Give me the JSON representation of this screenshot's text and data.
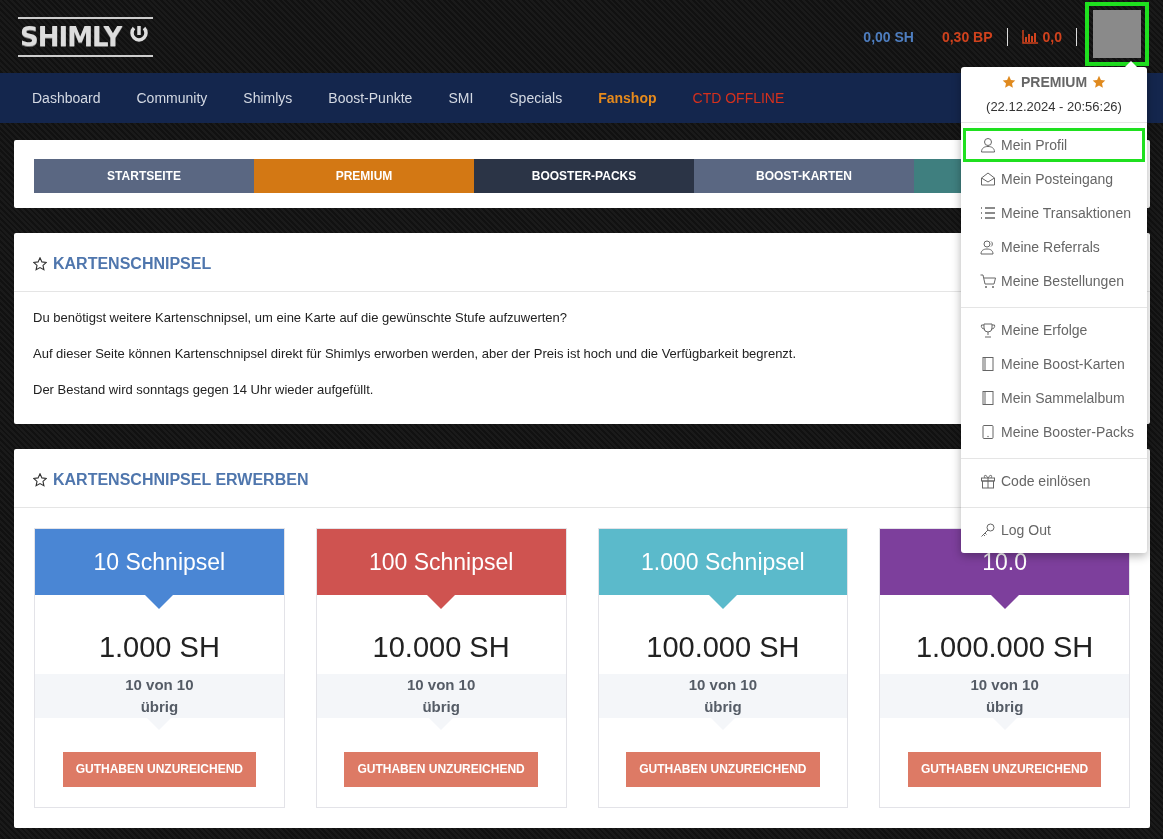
{
  "header": {
    "logo": "SHIMLY",
    "balances": [
      {
        "text": "0,00 SH",
        "kind": "sh"
      },
      {
        "text": "0,30 BP",
        "kind": "bp"
      },
      {
        "text": "0,0",
        "kind": "stats"
      }
    ],
    "avatar_highlighted": true
  },
  "nav": [
    {
      "label": "Dashboard",
      "kind": "normal"
    },
    {
      "label": "Community",
      "kind": "normal"
    },
    {
      "label": "Shimlys",
      "kind": "normal"
    },
    {
      "label": "Boost-Punkte",
      "kind": "normal"
    },
    {
      "label": "SMI",
      "kind": "normal"
    },
    {
      "label": "Specials",
      "kind": "normal"
    },
    {
      "label": "Fanshop",
      "kind": "active"
    },
    {
      "label": "CTD OFFLINE",
      "kind": "offline"
    }
  ],
  "shop_tabs": [
    {
      "label": "STARTSEITE",
      "color": "#5a6782"
    },
    {
      "label": "PREMIUM",
      "color": "#d37814"
    },
    {
      "label": "BOOSTER-PACKS",
      "color": "#2b3446"
    },
    {
      "label": "BOOST-KARTEN",
      "color": "#5a6782"
    },
    {
      "color": "#3f7f7f"
    }
  ],
  "info_panel": {
    "title": "KARTENSCHNIPSEL",
    "paragraphs": [
      "Du benötigst weitere Kartenschnipsel, um eine Karte auf die gewünschte Stufe aufzuwerten?",
      "Auf dieser Seite können Kartenschnipsel direkt für Shimlys erworben werden, aber der Preis ist hoch und die Verfügbarkeit begrenzt.",
      "Der Bestand wird sonntags gegen 14 Uhr wieder aufgefüllt."
    ]
  },
  "offers_panel": {
    "title": "KARTENSCHNIPSEL ERWERBEN",
    "cards": [
      {
        "title": "10 Schnipsel",
        "color": "#4a86d4",
        "price": "1.000 SH",
        "stock": "10 von 10",
        "stock_unit": "übrig",
        "button": "GUTHABEN UNZUREICHEND"
      },
      {
        "title": "100 Schnipsel",
        "color": "#cf5350",
        "price": "10.000 SH",
        "stock": "10 von 10",
        "stock_unit": "übrig",
        "button": "GUTHABEN UNZUREICHEND"
      },
      {
        "title": "1.000 Schnipsel",
        "color": "#5bbacb",
        "price": "100.000 SH",
        "stock": "10 von 10",
        "stock_unit": "übrig",
        "button": "GUTHABEN UNZUREICHEND"
      },
      {
        "title": "10.0",
        "color": "#7d3f9c",
        "price": "1.000.000 SH",
        "stock": "10 von 10",
        "stock_unit": "übrig",
        "button": "GUTHABEN UNZUREICHEND"
      }
    ]
  },
  "user_menu": {
    "status": "PREMIUM",
    "date": "(22.12.2024 - 20:56:26)",
    "groups": [
      [
        {
          "label": "Mein Profil",
          "selected": true
        },
        {
          "label": "Mein Posteingang",
          "selected": false
        },
        {
          "label": "Meine Transaktionen",
          "selected": false
        },
        {
          "label": "Meine Referrals",
          "selected": false
        },
        {
          "label": "Meine Bestellungen",
          "selected": false
        }
      ],
      [
        {
          "label": "Meine Erfolge",
          "selected": false
        },
        {
          "label": "Meine Boost-Karten",
          "selected": false
        },
        {
          "label": "Mein Sammelalbum",
          "selected": false
        },
        {
          "label": "Meine Booster-Packs",
          "selected": false
        }
      ],
      [
        {
          "label": "Code einlösen",
          "selected": false
        }
      ],
      [
        {
          "label": "Log Out",
          "selected": false
        }
      ]
    ]
  }
}
